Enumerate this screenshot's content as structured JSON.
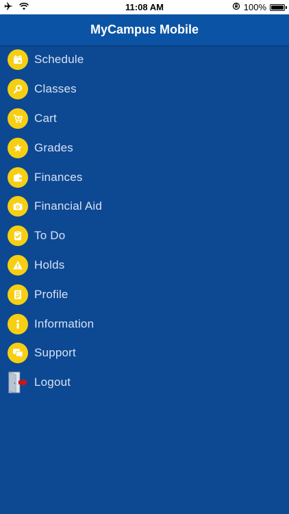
{
  "status_bar": {
    "time": "11:08 AM",
    "battery": "100%"
  },
  "header": {
    "title": "MyCampus Mobile"
  },
  "menu": {
    "items": [
      {
        "label": "Schedule",
        "icon": "calendar-icon"
      },
      {
        "label": "Classes",
        "icon": "search-icon"
      },
      {
        "label": "Cart",
        "icon": "cart-icon"
      },
      {
        "label": "Grades",
        "icon": "star-icon"
      },
      {
        "label": "Finances",
        "icon": "wallet-icon"
      },
      {
        "label": "Financial Aid",
        "icon": "camera-icon"
      },
      {
        "label": "To Do",
        "icon": "checklist-icon"
      },
      {
        "label": "Holds",
        "icon": "warning-icon"
      },
      {
        "label": "Profile",
        "icon": "profile-icon"
      },
      {
        "label": "Information",
        "icon": "info-icon"
      },
      {
        "label": "Support",
        "icon": "chat-icon"
      },
      {
        "label": "Logout",
        "icon": "logout-door-icon"
      }
    ]
  },
  "colors": {
    "background": "#0d4893",
    "header": "#0b54a5",
    "icon_circle": "#f6cf13",
    "label": "#d8e2f2"
  }
}
